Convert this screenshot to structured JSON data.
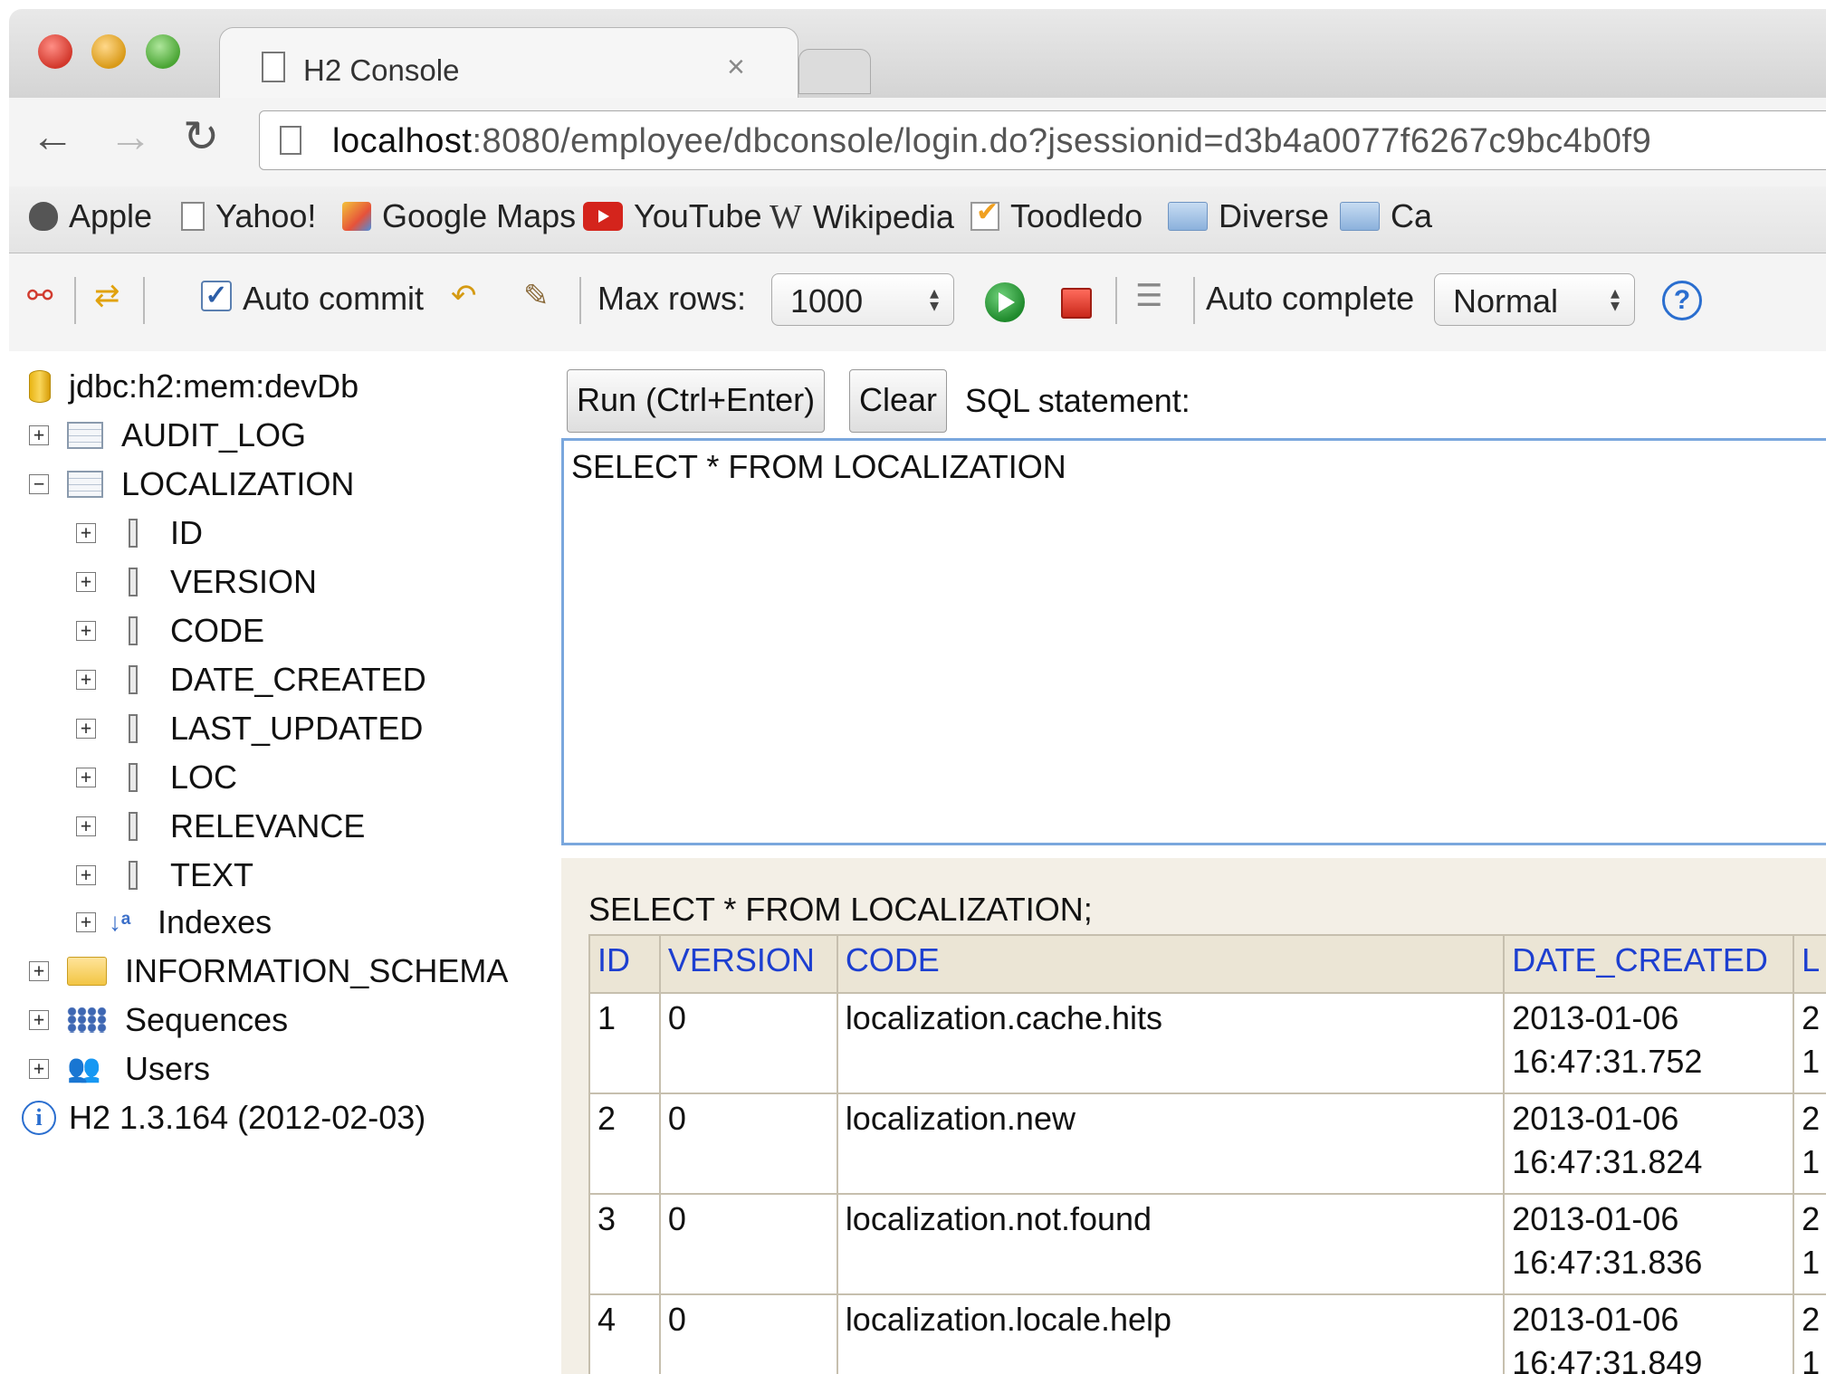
{
  "browser": {
    "tab_title": "H2 Console",
    "tab_close": "×",
    "url_host": "localhost",
    "url_rest": ":8080/employee/dbconsole/login.do?jsessionid=d3b4a0077f6267c9bc4b0f9",
    "bookmarks": [
      {
        "label": "Apple",
        "icon": "apple-icon"
      },
      {
        "label": "Yahoo!",
        "icon": "page-icon"
      },
      {
        "label": "Google Maps",
        "icon": "google-maps-icon"
      },
      {
        "label": "YouTube",
        "icon": "youtube-icon"
      },
      {
        "label": "Wikipedia",
        "icon": "wikipedia-icon"
      },
      {
        "label": "Toodledo",
        "icon": "toodledo-icon"
      },
      {
        "label": "Diverse",
        "icon": "folder-icon"
      },
      {
        "label": "Ca",
        "icon": "folder-icon"
      }
    ]
  },
  "toolbar": {
    "auto_commit_label": "Auto commit",
    "auto_commit_checked": true,
    "max_rows_label": "Max rows:",
    "max_rows_value": "1000",
    "auto_complete_label": "Auto complete",
    "auto_complete_value": "Normal",
    "help": "?"
  },
  "tree": {
    "connection": "jdbc:h2:mem:devDb",
    "audit_log": "AUDIT_LOG",
    "localization": "LOCALIZATION",
    "columns": [
      "ID",
      "VERSION",
      "CODE",
      "DATE_CREATED",
      "LAST_UPDATED",
      "LOC",
      "RELEVANCE",
      "TEXT"
    ],
    "indexes": "Indexes",
    "information_schema": "INFORMATION_SCHEMA",
    "sequences": "Sequences",
    "users": "Users",
    "version": "H2 1.3.164 (2012-02-03)"
  },
  "query": {
    "run_label": "Run (Ctrl+Enter)",
    "clear_label": "Clear",
    "sql_label": "SQL statement:",
    "sql_text": "SELECT * FROM LOCALIZATION"
  },
  "result": {
    "command": "SELECT * FROM LOCALIZATION;",
    "headers": [
      "ID",
      "VERSION",
      "CODE",
      "DATE_CREATED",
      "L"
    ],
    "rows": [
      {
        "id": "1",
        "version": "0",
        "code": "localization.cache.hits",
        "date": "2013-01-06",
        "time": "16:47:31.752",
        "l1": "2",
        "l2": "1"
      },
      {
        "id": "2",
        "version": "0",
        "code": "localization.new",
        "date": "2013-01-06",
        "time": "16:47:31.824",
        "l1": "2",
        "l2": "1"
      },
      {
        "id": "3",
        "version": "0",
        "code": "localization.not.found",
        "date": "2013-01-06",
        "time": "16:47:31.836",
        "l1": "2",
        "l2": "1"
      },
      {
        "id": "4",
        "version": "0",
        "code": "localization.locale.help",
        "date": "2013-01-06",
        "time": "16:47:31.849",
        "l1": "2",
        "l2": "1"
      }
    ]
  }
}
